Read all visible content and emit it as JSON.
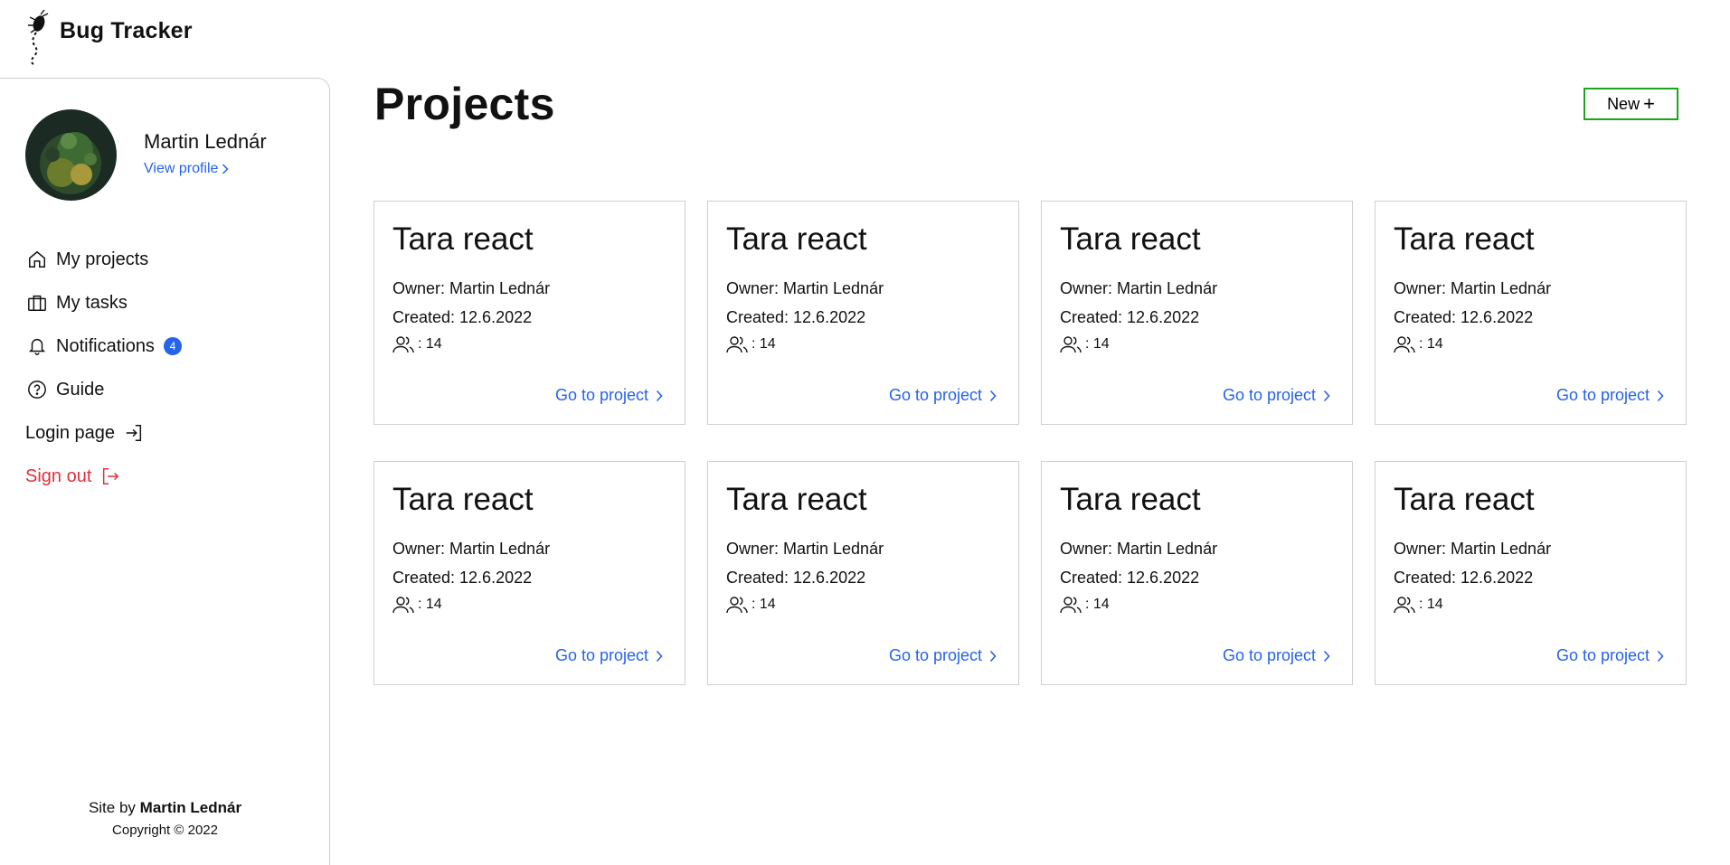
{
  "app": {
    "title": "Bug Tracker"
  },
  "profile": {
    "name": "Martin Lednár",
    "view_label": "View profile"
  },
  "nav": {
    "items": [
      {
        "label": "My projects",
        "icon": "home-icon"
      },
      {
        "label": "My tasks",
        "icon": "briefcase-icon"
      },
      {
        "label": "Notifications",
        "icon": "bell-icon",
        "badge": "4"
      },
      {
        "label": "Guide",
        "icon": "help-circle-icon"
      }
    ],
    "login_label": "Login page",
    "signout_label": "Sign out"
  },
  "footer": {
    "site_prefix": "Site by",
    "author": "Martin Lednár",
    "copyright": "Copyright © 2022"
  },
  "main": {
    "title": "Projects",
    "new_label": "New"
  },
  "projects": [
    {
      "name": "Tara react",
      "owner": "Owner: Martin Lednár",
      "created": "Created: 12.6.2022",
      "members": ": 14",
      "link": "Go to project"
    },
    {
      "name": "Tara react",
      "owner": "Owner: Martin Lednár",
      "created": "Created: 12.6.2022",
      "members": ": 14",
      "link": "Go to project"
    },
    {
      "name": "Tara react",
      "owner": "Owner: Martin Lednár",
      "created": "Created: 12.6.2022",
      "members": ": 14",
      "link": "Go to project"
    },
    {
      "name": "Tara react",
      "owner": "Owner: Martin Lednár",
      "created": "Created: 12.6.2022",
      "members": ": 14",
      "link": "Go to project"
    },
    {
      "name": "Tara react",
      "owner": "Owner: Martin Lednár",
      "created": "Created: 12.6.2022",
      "members": ": 14",
      "link": "Go to project"
    },
    {
      "name": "Tara react",
      "owner": "Owner: Martin Lednár",
      "created": "Created: 12.6.2022",
      "members": ": 14",
      "link": "Go to project"
    },
    {
      "name": "Tara react",
      "owner": "Owner: Martin Lednár",
      "created": "Created: 12.6.2022",
      "members": ": 14",
      "link": "Go to project"
    },
    {
      "name": "Tara react",
      "owner": "Owner: Martin Lednár",
      "created": "Created: 12.6.2022",
      "members": ": 14",
      "link": "Go to project"
    }
  ],
  "colors": {
    "accent": "#2563eb",
    "danger": "#e0303a",
    "success": "#1aa51a",
    "border": "#cfcfcf"
  }
}
